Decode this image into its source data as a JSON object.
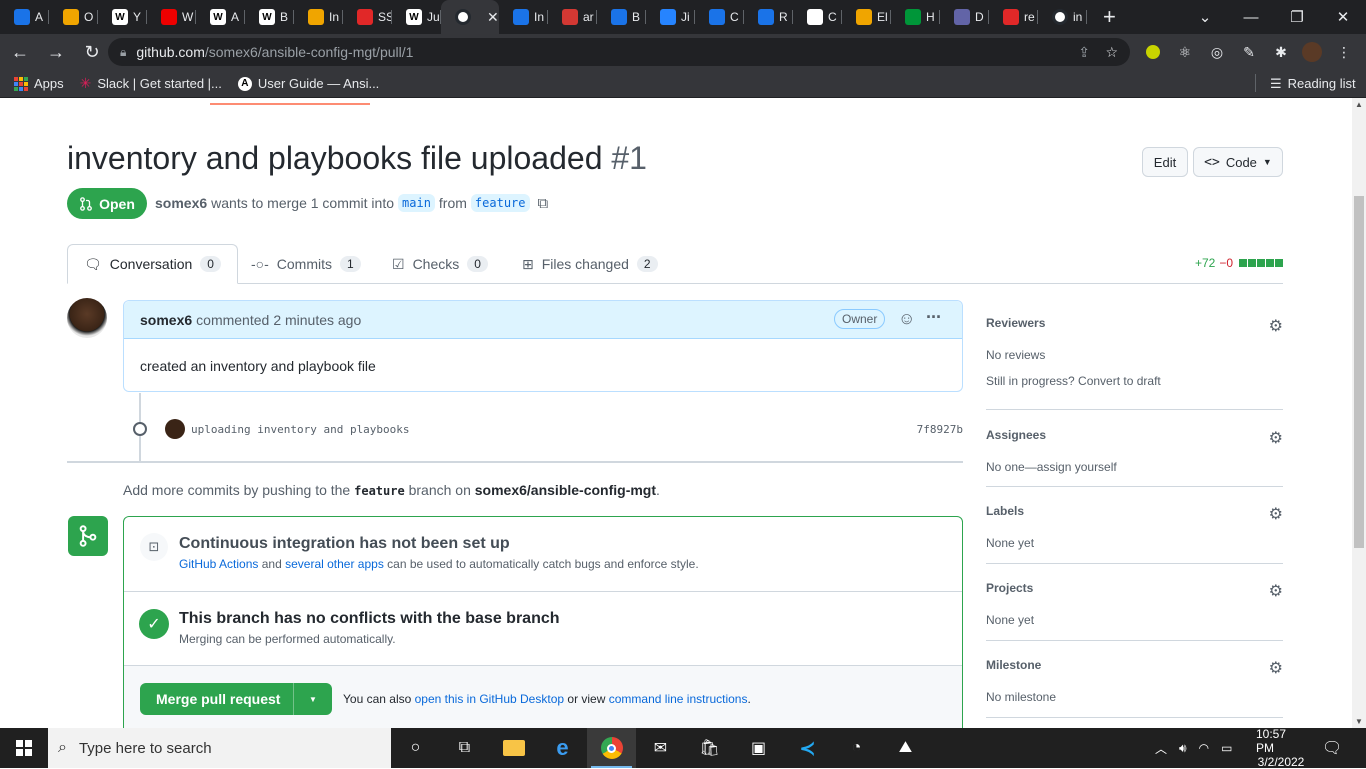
{
  "browser": {
    "tabs": [
      {
        "label": "A",
        "icon": "ansible-favicon",
        "color": "#1a73e8"
      },
      {
        "label": "O",
        "icon": "amazon-box-favicon",
        "color": "#f0a500"
      },
      {
        "label": "Y",
        "icon": "wikipedia-favicon",
        "color": "#ffffff"
      },
      {
        "label": "W",
        "icon": "redhat-favicon",
        "color": "#ee0000"
      },
      {
        "label": "A",
        "icon": "wikipedia-favicon",
        "color": "#ffffff"
      },
      {
        "label": "B",
        "icon": "wikipedia-favicon",
        "color": "#ffffff"
      },
      {
        "label": "In",
        "icon": "amazon-box-favicon",
        "color": "#f0a500"
      },
      {
        "label": "SS",
        "icon": "scribd-favicon",
        "color": "#e12828"
      },
      {
        "label": "Ju",
        "icon": "wikipedia-favicon",
        "color": "#ffffff"
      },
      {
        "label": "",
        "icon": "github-favicon",
        "color": "#24292f",
        "active": true
      },
      {
        "label": "In",
        "icon": "ansible-favicon",
        "color": "#1a73e8"
      },
      {
        "label": "ar",
        "icon": "jenkins-favicon",
        "color": "#d33833"
      },
      {
        "label": "B",
        "icon": "ansible-favicon",
        "color": "#1a73e8"
      },
      {
        "label": "Ji",
        "icon": "jira-favicon",
        "color": "#2684ff"
      },
      {
        "label": "C",
        "icon": "ansible-favicon",
        "color": "#1a73e8"
      },
      {
        "label": "R",
        "icon": "ansible-favicon",
        "color": "#1a73e8"
      },
      {
        "label": "C",
        "icon": "medium-favicon",
        "color": "#ffffff"
      },
      {
        "label": "El",
        "icon": "amazon-box-favicon",
        "color": "#f0a500"
      },
      {
        "label": "H",
        "icon": "nginx-favicon",
        "color": "#009639"
      },
      {
        "label": "D",
        "icon": "teams-favicon",
        "color": "#6264a7"
      },
      {
        "label": "re",
        "icon": "list-favicon",
        "color": "#e12828"
      },
      {
        "label": "in",
        "icon": "github-favicon",
        "color": "#24292f"
      }
    ],
    "url_host": "github.com",
    "url_path": "/somex6/ansible-config-mgt/pull/1",
    "bookmarks": [
      {
        "label": "Apps",
        "icon": "apps-grid-icon"
      },
      {
        "label": "Slack | Get started |...",
        "icon": "slack-icon"
      },
      {
        "label": "User Guide — Ansi...",
        "icon": "ansible-icon"
      }
    ],
    "reading_list": "Reading list"
  },
  "pr": {
    "title": "inventory and playbooks file uploaded",
    "number": "#1",
    "edit_label": "Edit",
    "code_label": "Code",
    "state": "Open",
    "author": "somex6",
    "merge_text": "wants to merge 1 commit into",
    "base_branch": "main",
    "from_text": "from",
    "head_branch": "feature"
  },
  "tabs": [
    {
      "label": "Conversation",
      "count": "0",
      "icon": "comment-icon"
    },
    {
      "label": "Commits",
      "count": "1",
      "icon": "commit-icon"
    },
    {
      "label": "Checks",
      "count": "0",
      "icon": "checklist-icon"
    },
    {
      "label": "Files changed",
      "count": "2",
      "icon": "file-diff-icon"
    }
  ],
  "diffstat": {
    "added": "+72",
    "removed": "−0",
    "added_color": "#2da44e",
    "removed_color": "#cf222e",
    "blocks": 5
  },
  "comment": {
    "author": "somex6",
    "action": "commented",
    "time": "2 minutes ago",
    "role": "Owner",
    "body": "created an inventory and playbook file"
  },
  "commit": {
    "message": "uploading inventory and playbooks",
    "sha": "7f8927b"
  },
  "hint": {
    "prefix": "Add more commits by pushing to the",
    "branch": "feature",
    "middle": "branch on",
    "repo": "somex6/ansible-config-mgt",
    "suffix": "."
  },
  "checks": {
    "ci_title": "Continuous integration has not been set up",
    "ci_link1": "GitHub Actions",
    "ci_and": "and",
    "ci_link2": "several other apps",
    "ci_rest": "can be used to automatically catch bugs and enforce style.",
    "conflict_title": "This branch has no conflicts with the base branch",
    "conflict_sub": "Merging can be performed automatically.",
    "merge_button": "Merge pull request",
    "also_text": "You can also",
    "desktop_link": "open this in GitHub Desktop",
    "or_view": "or view",
    "cli_link": "command line instructions",
    "period": "."
  },
  "sidebar": [
    {
      "title": "Reviewers",
      "lines": [
        "No reviews",
        "Still in progress? Convert to draft"
      ]
    },
    {
      "title": "Assignees",
      "lines": [
        "No one—assign yourself"
      ]
    },
    {
      "title": "Labels",
      "lines": [
        "None yet"
      ]
    },
    {
      "title": "Projects",
      "lines": [
        "None yet"
      ]
    },
    {
      "title": "Milestone",
      "lines": [
        "No milestone"
      ]
    }
  ],
  "taskbar": {
    "search_placeholder": "Type here to search",
    "time": "10:57 PM",
    "date": "3/2/2022"
  }
}
